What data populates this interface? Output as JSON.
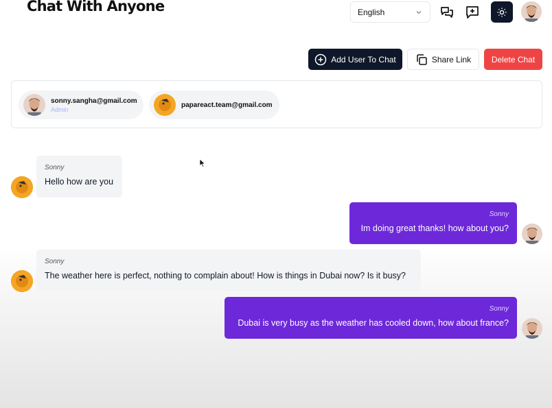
{
  "header": {
    "title": "Chat With Anyone",
    "language": "English"
  },
  "icons": {
    "chats": "chats-icon",
    "new_chat": "new-chat-icon",
    "theme": "sun-icon"
  },
  "actions": {
    "add_user": "Add User To Chat",
    "share_link": "Share Link",
    "delete_chat": "Delete Chat"
  },
  "participants": [
    {
      "email": "sonny.sangha@gmail.com",
      "role": "Admin"
    },
    {
      "email": "papareact.team@gmail.com",
      "role": ""
    }
  ],
  "messages": [
    {
      "sender": "Sonny",
      "text": "Hello how are you",
      "side": "left"
    },
    {
      "sender": "Sonny",
      "text": "Im doing great thanks! how about you?",
      "side": "right"
    },
    {
      "sender": "Sonny",
      "text": "The weather here is perfect, nothing to complain about! How is things in Dubai now? Is it busy?",
      "side": "left"
    },
    {
      "sender": "Sonny",
      "text": "Dubai is very busy as the weather has cooled down, how about france?",
      "side": "right"
    }
  ],
  "colors": {
    "primary_dark": "#0f172a",
    "delete_red": "#ef4444",
    "message_purple": "#6d28d9",
    "message_gray": "#f3f4f6"
  }
}
